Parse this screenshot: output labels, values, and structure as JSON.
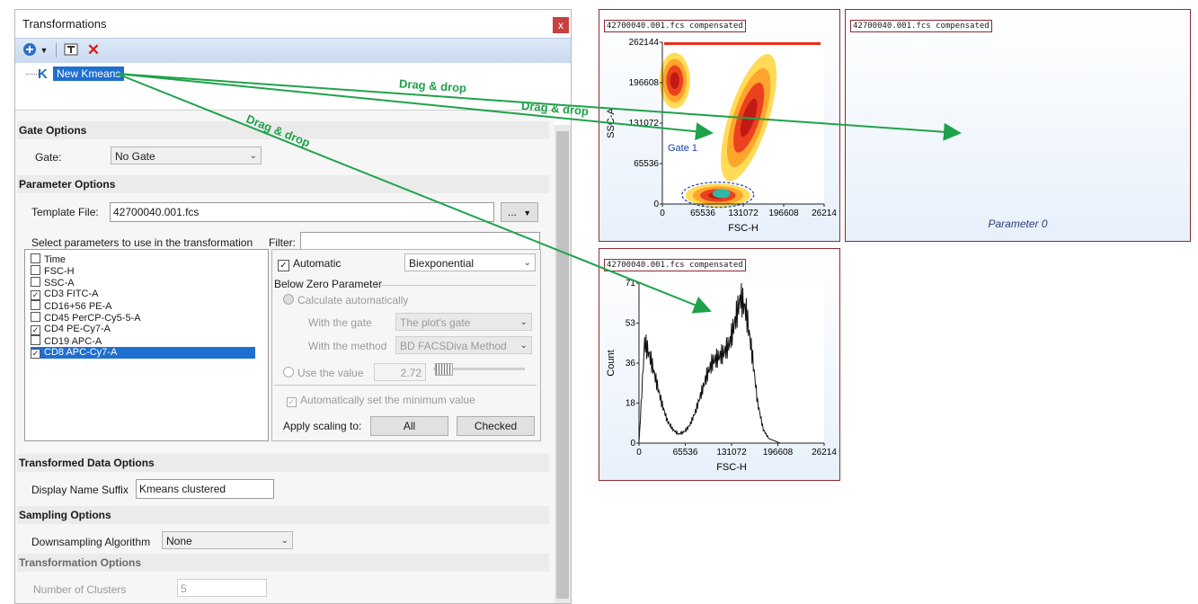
{
  "dialog": {
    "title": "Transformations",
    "close_glyph": "x",
    "toolbar": {
      "add_icon": "add-circle-icon",
      "dropdown_icon": "chevron-down-icon",
      "rename_icon": "rename-icon",
      "delete_icon": "delete-x-icon"
    },
    "tree": {
      "node_icon_letter": "K",
      "node_label": "New Kmeans"
    },
    "gate_options": {
      "header": "Gate Options",
      "gate_label": "Gate:",
      "gate_value": "No Gate"
    },
    "parameter_options": {
      "header": "Parameter Options",
      "template_label": "Template File:",
      "template_value": "42700040.001.fcs",
      "browse_label": "...",
      "select_label": "Select parameters to use in the transformation",
      "filter_label": "Filter:",
      "filter_value": "",
      "parameters": [
        {
          "label": "Time",
          "checked": false,
          "selected": false
        },
        {
          "label": "FSC-H",
          "checked": false,
          "selected": false
        },
        {
          "label": "SSC-A",
          "checked": false,
          "selected": false
        },
        {
          "label": "CD3 FITC-A",
          "checked": true,
          "selected": false
        },
        {
          "label": "CD16+56 PE-A",
          "checked": false,
          "selected": false
        },
        {
          "label": "CD45 PerCP-Cy5-5-A",
          "checked": false,
          "selected": false
        },
        {
          "label": "CD4 PE-Cy7-A",
          "checked": true,
          "selected": false
        },
        {
          "label": "CD19 APC-A",
          "checked": false,
          "selected": false
        },
        {
          "label": "CD8 APC-Cy7-A",
          "checked": true,
          "selected": true
        }
      ],
      "automatic_label": "Automatic",
      "automatic_checked": true,
      "scale_value": "Biexponential",
      "below_zero_label": "Below Zero Parameter",
      "calc_auto_label": "Calculate automatically",
      "with_gate_label": "With the gate",
      "with_gate_value": "The plot's gate",
      "with_method_label": "With the method",
      "with_method_value": "BD FACSDiva Method",
      "use_value_label": "Use the value",
      "use_value": "2.72",
      "auto_min_label": "Automatically set the minimum value",
      "apply_label": "Apply scaling to:",
      "all_button": "All",
      "checked_button": "Checked"
    },
    "transformed_data": {
      "header": "Transformed Data Options",
      "suffix_label": "Display Name Suffix",
      "suffix_value": "Kmeans clustered"
    },
    "sampling": {
      "header": "Sampling Options",
      "algo_label": "Downsampling Algorithm",
      "algo_value": "None"
    },
    "transformation": {
      "header": "Transformation Options",
      "clusters_label": "Number of Clusters",
      "clusters_value": "5"
    }
  },
  "plots": {
    "scatter": {
      "title": "42700040.001.fcs compensated",
      "xlabel": "FSC-H",
      "ylabel": "SSC-A",
      "x_ticks": [
        "0",
        "65536",
        "131072",
        "196608",
        "26214"
      ],
      "y_ticks": [
        "262144",
        "196608",
        "131072",
        "65536",
        "0"
      ],
      "gate_label": "Gate 1"
    },
    "empty": {
      "title": "42700040.001.fcs compensated",
      "placeholder": "Parameter 0"
    },
    "histogram": {
      "title": "42700040.001.fcs compensated",
      "xlabel": "FSC-H",
      "ylabel": "Count",
      "x_ticks": [
        "0",
        "65536",
        "131072",
        "196608",
        "26214"
      ],
      "y_ticks": [
        "71",
        "53",
        "36",
        "18",
        "0"
      ]
    }
  },
  "annotations": {
    "drag_labels": [
      "Drag & drop",
      "Drag & drop",
      "Drag & drop"
    ],
    "arrow_color": "#1fa24a"
  },
  "chart_data": [
    {
      "type": "scatter",
      "title": "42700040.001.fcs compensated",
      "xlabel": "FSC-H",
      "ylabel": "SSC-A",
      "xlim": [
        0,
        262144
      ],
      "ylim": [
        0,
        262144
      ],
      "populations": [
        {
          "x_center": 20000,
          "y_center": 200000,
          "density": "high"
        },
        {
          "x_center": 140000,
          "y_center": 140000,
          "density": "high"
        },
        {
          "x_center": 90000,
          "y_center": 14000,
          "density": "very-high"
        }
      ]
    },
    {
      "type": "line",
      "title": "42700040.001.fcs compensated",
      "xlabel": "FSC-H",
      "ylabel": "Count",
      "xlim": [
        0,
        262144
      ],
      "ylim": [
        0,
        71
      ],
      "x": [
        0,
        8000,
        16000,
        24000,
        32000,
        40000,
        48000,
        56000,
        64000,
        72000,
        80000,
        88000,
        96000,
        104000,
        112000,
        120000,
        128000,
        136000,
        144000,
        152000,
        160000,
        168000,
        176000,
        184000,
        192000,
        200000,
        220000,
        240000,
        262144
      ],
      "y": [
        0,
        45,
        38,
        28,
        18,
        10,
        6,
        4,
        5,
        8,
        14,
        22,
        30,
        36,
        38,
        40,
        44,
        54,
        65,
        58,
        40,
        18,
        6,
        2,
        1,
        0,
        0,
        0,
        0
      ]
    }
  ]
}
